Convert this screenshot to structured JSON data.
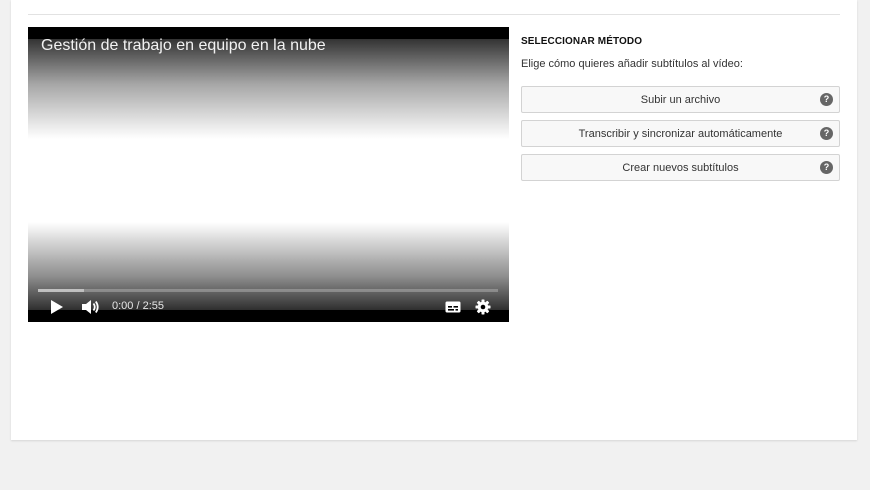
{
  "video": {
    "title": "Gestión de trabajo en equipo en la nube",
    "time": "0:00 / 2:55",
    "progress_played_fraction": 0.0,
    "progress_loaded_fraction": 0.1
  },
  "panel": {
    "heading": "SELECCIONAR MÉTODO",
    "description": "Elige cómo quieres añadir subtítulos al vídeo:",
    "methods": [
      {
        "label": "Subir un archivo",
        "help": "?"
      },
      {
        "label": "Transcribir y sincronizar automáticamente",
        "help": "?"
      },
      {
        "label": "Crear nuevos subtítulos",
        "help": "?"
      }
    ]
  },
  "icons": {
    "play": "play-icon",
    "volume": "volume-icon",
    "subtitles": "subtitles-icon",
    "settings": "gear-icon",
    "help": "help-icon"
  },
  "colors": {
    "page_background": "#f1f1f1",
    "card_background": "#ffffff",
    "player_background": "#000000",
    "button_background": "#f8f8f8",
    "button_border": "#d3d3d3",
    "help_icon": "#666666"
  }
}
